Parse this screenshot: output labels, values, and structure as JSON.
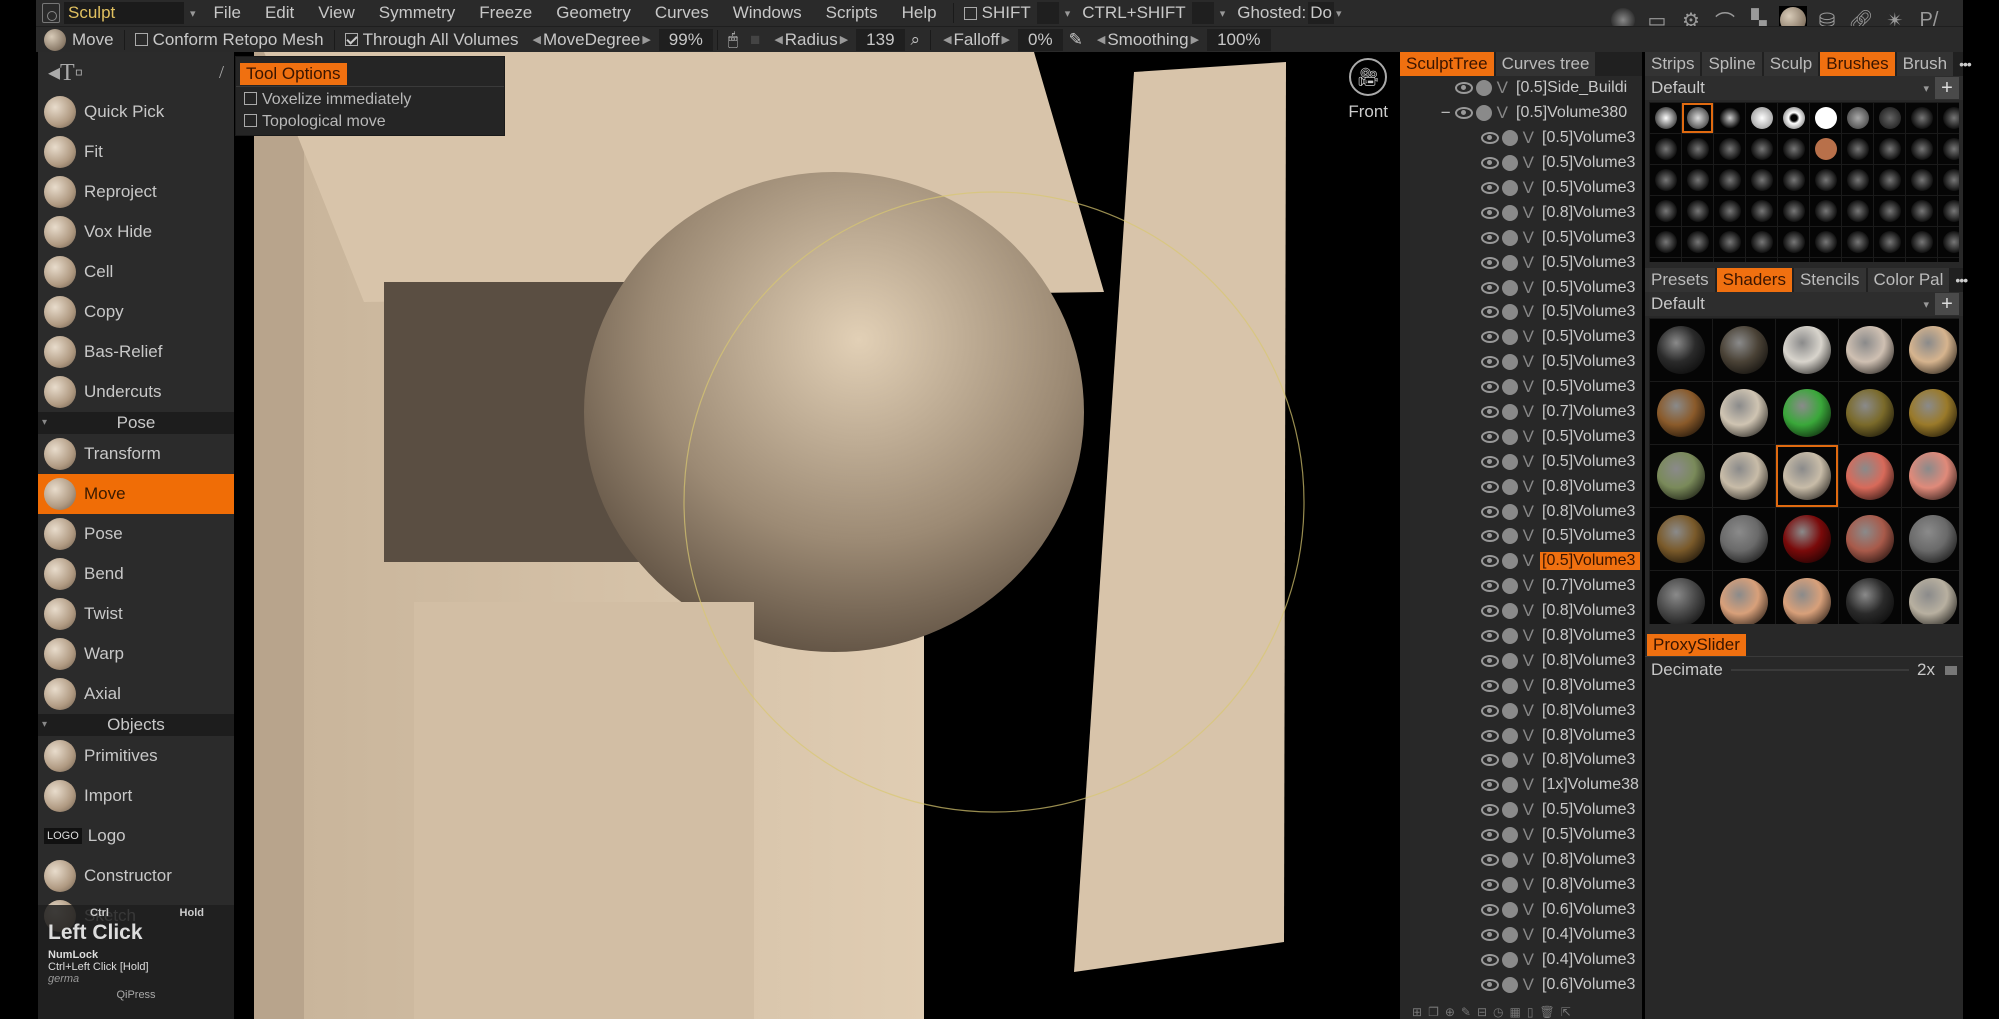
{
  "menubar": {
    "room": "Sculpt",
    "items": [
      "File",
      "Edit",
      "View",
      "Symmetry",
      "Freeze",
      "Geometry",
      "Curves",
      "Windows",
      "Scripts",
      "Help"
    ],
    "shift_label": "SHIFT",
    "ctrl_shift_label": "CTRL+SHIFT",
    "ghosted_label": "Ghosted:",
    "ghosted_value": "Do",
    "right_icons": [
      "soft-sphere-icon",
      "frame-icon",
      "gear-brush-icon",
      "curve-icon",
      "checker-icon",
      "shader-sphere-icon",
      "primitives-icon",
      "link-icon",
      "light-icon",
      "paint-brush-icon"
    ]
  },
  "toolbar": {
    "tool_name": "Move",
    "conform_label": "Conform Retopo Mesh",
    "conform_checked": false,
    "through_label": "Through All Volumes",
    "through_checked": true,
    "movedegree_label": "MoveDegree",
    "movedegree_value": "99%",
    "radius_label": "Radius",
    "radius_value": "139",
    "falloff_label": "Falloff",
    "falloff_value": "0%",
    "smoothing_label": "Smoothing",
    "smoothing_value": "100%"
  },
  "left_tools": {
    "group1": [
      "Quick Pick",
      "Fit",
      "Reproject",
      "Vox Hide",
      "Cell",
      "Copy",
      "Bas-Relief",
      "Undercuts"
    ],
    "pose_section": "Pose",
    "group2": [
      "Transform",
      "Move",
      "Pose",
      "Bend",
      "Twist",
      "Warp",
      "Axial"
    ],
    "active_tool": "Move",
    "objects_section": "Objects",
    "group3": [
      "Primitives",
      "Import",
      "Logo",
      "Constructor",
      "Sketch"
    ],
    "logo_badge": "LOGO"
  },
  "hint_overlay": {
    "ctrl": "Ctrl",
    "hold": "Hold",
    "action": "Left Click",
    "numlock": "NumLock",
    "combo": "Ctrl+Left Click [Hold]",
    "note": "germa",
    "app": "QiPress"
  },
  "tool_options": {
    "title": "Tool Options",
    "options": [
      {
        "label": "Voxelize immediately",
        "checked": false
      },
      {
        "label": "Topological move",
        "checked": false
      }
    ]
  },
  "viewport": {
    "camera_label": "Front"
  },
  "sculpt_tree": {
    "tabs": [
      "SculptTree",
      "Curves tree"
    ],
    "active_tab": "SculptTree",
    "rows": [
      {
        "name": "[0.5]Side_Buildi",
        "indent": 0
      },
      {
        "name": "[0.5]Volume380",
        "indent": 0,
        "collapse": "−"
      },
      {
        "name": "[0.5]Volume3"
      },
      {
        "name": "[0.5]Volume3"
      },
      {
        "name": "[0.5]Volume3"
      },
      {
        "name": "[0.8]Volume3"
      },
      {
        "name": "[0.5]Volume3"
      },
      {
        "name": "[0.5]Volume3"
      },
      {
        "name": "[0.5]Volume3"
      },
      {
        "name": "[0.5]Volume3"
      },
      {
        "name": "[0.5]Volume3"
      },
      {
        "name": "[0.5]Volume3"
      },
      {
        "name": "[0.5]Volume3"
      },
      {
        "name": "[0.7]Volume3"
      },
      {
        "name": "[0.5]Volume3"
      },
      {
        "name": "[0.5]Volume3"
      },
      {
        "name": "[0.8]Volume3"
      },
      {
        "name": "[0.8]Volume3"
      },
      {
        "name": "[0.5]Volume3"
      },
      {
        "name": "[0.5]Volume3",
        "selected": true
      },
      {
        "name": "[0.7]Volume3"
      },
      {
        "name": "[0.8]Volume3"
      },
      {
        "name": "[0.8]Volume3"
      },
      {
        "name": "[0.8]Volume3"
      },
      {
        "name": "[0.8]Volume3"
      },
      {
        "name": "[0.8]Volume3"
      },
      {
        "name": "[0.8]Volume3"
      },
      {
        "name": "[0.8]Volume3"
      },
      {
        "name": "[1x]Volume38"
      },
      {
        "name": "[0.5]Volume3"
      },
      {
        "name": "[0.5]Volume3"
      },
      {
        "name": "[0.8]Volume3"
      },
      {
        "name": "[0.8]Volume3"
      },
      {
        "name": "[0.6]Volume3"
      },
      {
        "name": "[0.4]Volume3"
      },
      {
        "name": "[0.4]Volume3"
      },
      {
        "name": "[0.6]Volume3"
      }
    ],
    "visibility_letter": "V"
  },
  "brushes_panel": {
    "tabs": [
      "Strips",
      "Spline",
      "Sculp",
      "Brushes",
      "Brush"
    ],
    "active_tab": "Brushes",
    "preset": "Default",
    "selected_index": 1,
    "count": 60
  },
  "shaders_panel": {
    "tabs": [
      "Presets",
      "Shaders",
      "Stencils",
      "Color Pal"
    ],
    "active_tab": "Shaders",
    "preset": "Default",
    "selected_index": 12,
    "colors": [
      "#2a2a2a",
      "#4a4236",
      "#d8d4cc",
      "#cfc0b2",
      "#d6b48e",
      "#8a5a2a",
      "#cfc4b2",
      "#3aa83a",
      "#7a6a2a",
      "#9a7a2a",
      "#7a8a5a",
      "#c8bca8",
      "#c8bca8",
      "#d86a5a",
      "#e08a7a",
      "#7a5a2a",
      "#6a6a6a",
      "#7a0a0a",
      "#a85a4a",
      "#6a6a6a",
      "#4a4a4a",
      "#d8a07a",
      "#d8a07a",
      "#2a2a2a",
      "#b8b0a0"
    ]
  },
  "proxy_slider": {
    "title": "ProxySlider",
    "decimate_label": "Decimate",
    "decimate_value": "2x"
  },
  "colors": {
    "accent": "#f07010",
    "panel": "#2b2b2b",
    "viewport": "#000000",
    "model": "#d6c2a8"
  }
}
